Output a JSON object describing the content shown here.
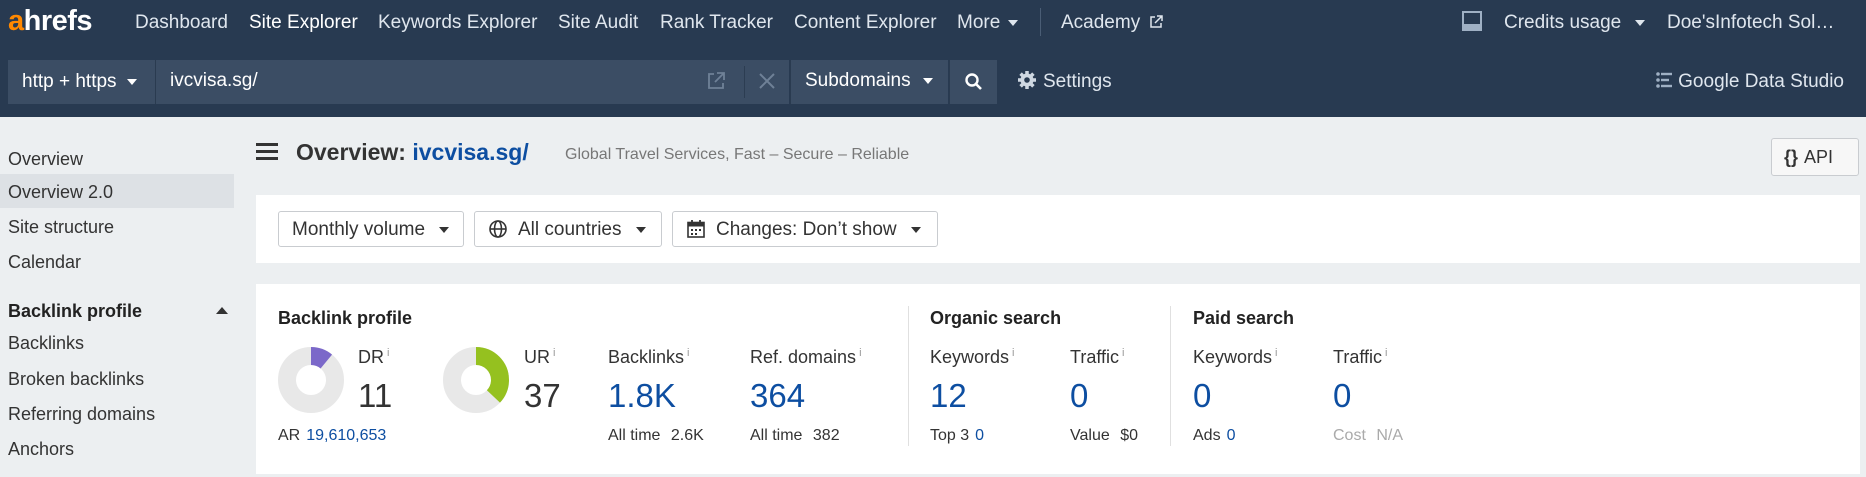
{
  "nav": {
    "logo_a": "a",
    "logo_rest": "hrefs",
    "items": [
      "Dashboard",
      "Site Explorer",
      "Keywords Explorer",
      "Site Audit",
      "Rank Tracker",
      "Content Explorer"
    ],
    "more": "More",
    "academy": "Academy",
    "credits": "Credits usage",
    "account": "Doe'sInfotech Sol…",
    "active_item": "Site Explorer"
  },
  "search": {
    "protocol": "http + https",
    "url": "ivcvisa.sg/",
    "mode": "Subdomains",
    "settings": "Settings",
    "gds": "Google Data Studio"
  },
  "sidebar": {
    "items": [
      "Overview",
      "Overview 2.0",
      "Site structure",
      "Calendar"
    ],
    "active_item": "Overview 2.0",
    "section": "Backlink profile",
    "section_items": [
      "Backlinks",
      "Broken backlinks",
      "Referring domains",
      "Anchors"
    ]
  },
  "header": {
    "title_prefix": "Overview:",
    "domain": "ivcvisa.sg/",
    "subtitle": "Global Travel Services, Fast – Secure – Reliable",
    "api": "API"
  },
  "filters": {
    "volume": "Monthly volume",
    "countries": "All countries",
    "changes": "Changes: Don’t show"
  },
  "metrics": {
    "backlink_profile": {
      "title": "Backlink profile",
      "dr_label": "DR",
      "dr_value": "11",
      "dr_fraction": 0.11,
      "ar_label": "AR",
      "ar_value": "19,610,653",
      "ur_label": "UR",
      "ur_value": "37",
      "ur_fraction": 0.37,
      "backlinks_label": "Backlinks",
      "backlinks_value": "1.8K",
      "backlinks_sub_label": "All time",
      "backlinks_sub_value": "2.6K",
      "refdomains_label": "Ref. domains",
      "refdomains_value": "364",
      "refdomains_sub_label": "All time",
      "refdomains_sub_value": "382"
    },
    "organic": {
      "title": "Organic search",
      "keywords_label": "Keywords",
      "keywords_value": "12",
      "keywords_sub_label": "Top 3",
      "keywords_sub_value": "0",
      "traffic_label": "Traffic",
      "traffic_value": "0",
      "traffic_sub_label": "Value",
      "traffic_sub_value": "$0"
    },
    "paid": {
      "title": "Paid search",
      "keywords_label": "Keywords",
      "keywords_value": "0",
      "keywords_sub_label": "Ads",
      "keywords_sub_value": "0",
      "traffic_label": "Traffic",
      "traffic_value": "0",
      "traffic_sub_label": "Cost",
      "traffic_sub_value": "N/A"
    },
    "info_marker": "i"
  },
  "colors": {
    "nav_bg": "#283a51",
    "logo_orange": "#ff8800",
    "link_blue": "#0d4ea1",
    "dr_purple": "#7b68c9",
    "ur_green": "#95c11f",
    "donut_track": "#e8e8e8"
  }
}
